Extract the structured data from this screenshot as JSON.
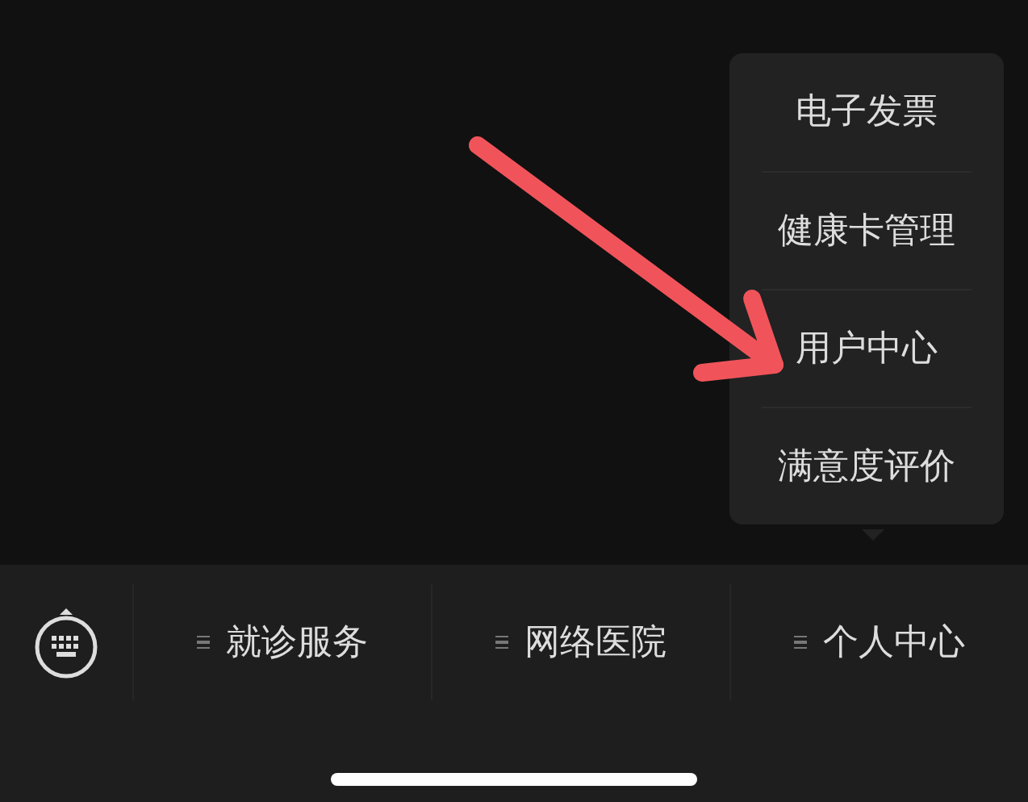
{
  "popup_menu": {
    "items": [
      "电子发票",
      "健康卡管理",
      "用户中心",
      "满意度评价"
    ]
  },
  "menu_bar": {
    "items": [
      {
        "label": "就诊服务"
      },
      {
        "label": "网络医院"
      },
      {
        "label": "个人中心"
      }
    ]
  }
}
